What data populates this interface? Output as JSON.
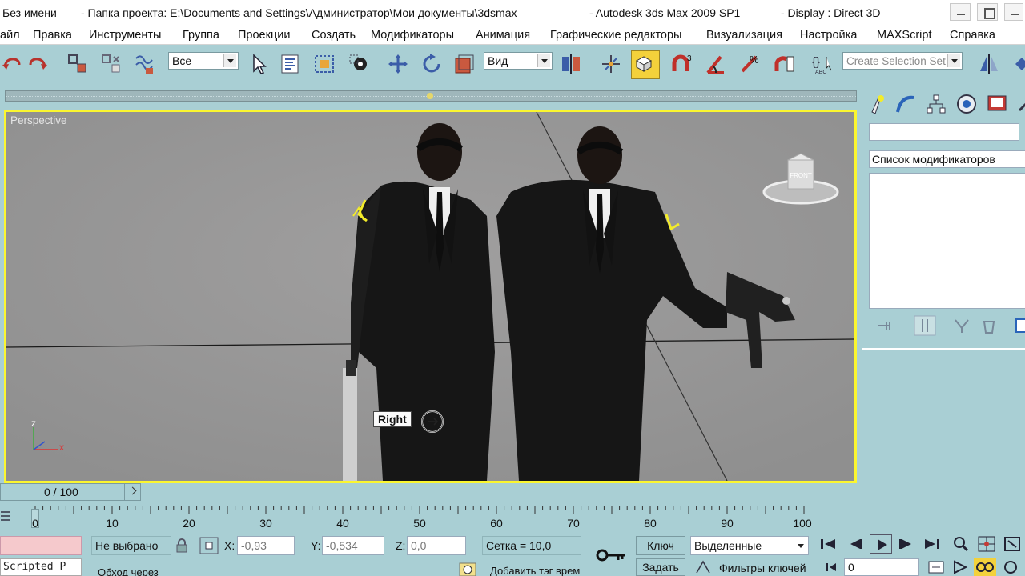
{
  "title": {
    "file": "Без имени",
    "project": "- Папка проекта: E:\\Documents and Settings\\Администратор\\Мои документы\\3dsmax",
    "app": "- Autodesk 3ds Max  2009 SP1",
    "display": "- Display : Direct 3D"
  },
  "menu": [
    "айл",
    "Правка",
    "Инструменты",
    "Группа",
    "Проекции",
    "Создать",
    "Модификаторы",
    "Анимация",
    "Графические редакторы",
    "Визуализация",
    "Настройка",
    "MAXScript",
    "Справка"
  ],
  "toolbar": {
    "filter_value": "Все",
    "ref_coord_value": "Вид",
    "selection_set_placeholder": "Create Selection Set"
  },
  "viewport": {
    "label": "Perspective",
    "tooltip": "Right",
    "viewcube_face": "FRONT",
    "axis_z": "z",
    "axis_x": "x"
  },
  "command_panel": {
    "modifier_list": "Список модификаторов"
  },
  "timeline": {
    "frame_counter": "0 / 100",
    "ticks": [
      "0",
      "10",
      "20",
      "30",
      "40",
      "50",
      "60",
      "70",
      "80",
      "90",
      "100"
    ]
  },
  "status": {
    "maxscript_label": "Scripted P",
    "selection": "Не выбрано",
    "x_label": "X:",
    "x_value": "-0,93",
    "y_label": "Y:",
    "y_value": "-0,534",
    "z_label": "Z:",
    "z_value": "0,0",
    "grid": "Сетка = 10,0",
    "key_label": "Ключ",
    "set_key_label": "Задать",
    "key_mode": "Выделенные",
    "key_filters": "Фильтры ключей",
    "prompt": "Обход через",
    "add_tag": "Добавить тэг врем",
    "current_frame": "0"
  }
}
